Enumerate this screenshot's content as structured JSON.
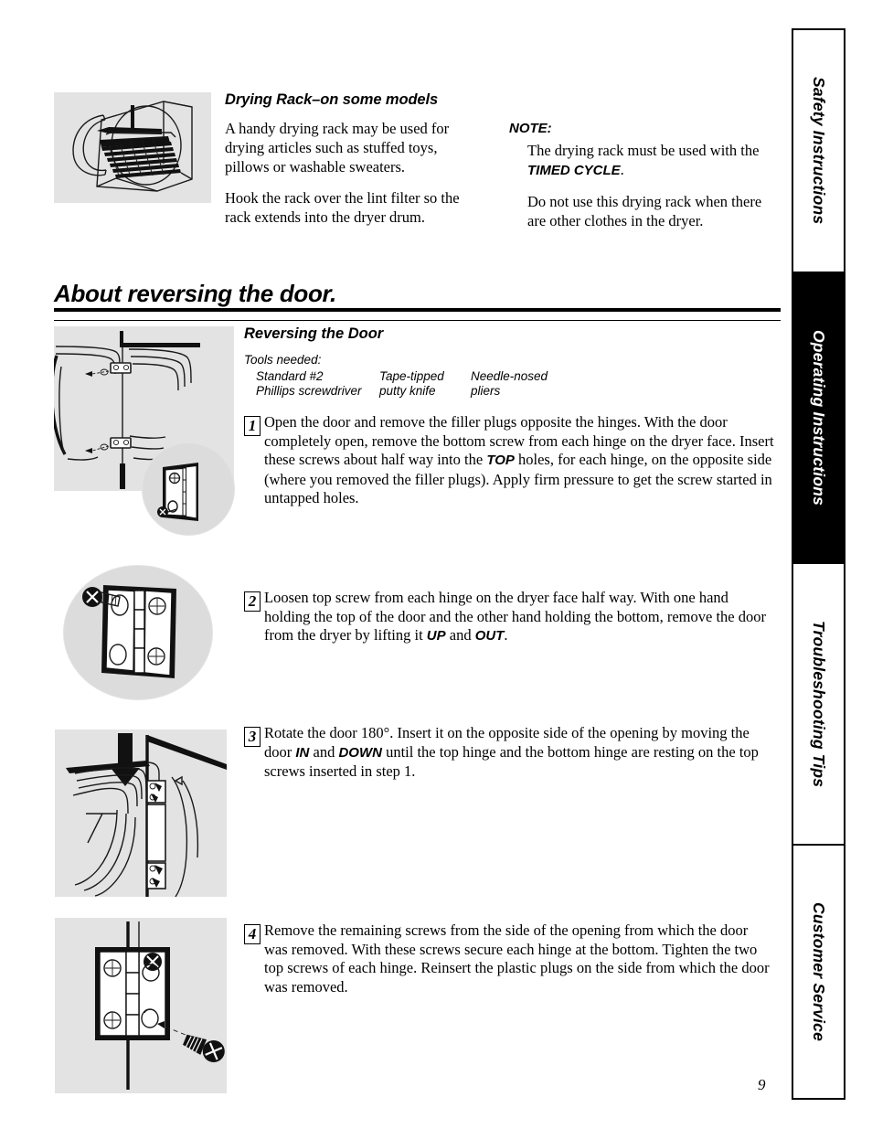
{
  "page_number": "9",
  "sidebar": {
    "tabs": [
      {
        "label": "Safety Instructions",
        "active": false
      },
      {
        "label": "Operating Instructions",
        "active": true
      },
      {
        "label": "Troubleshooting Tips",
        "active": false
      },
      {
        "label": "Customer Service",
        "active": false
      }
    ]
  },
  "drying_rack": {
    "heading": "Drying Rack–on some models",
    "paragraph_1": "A handy drying rack may be used for drying articles such as stuffed toys, pillows or washable sweaters.",
    "paragraph_2": "Hook the rack over the lint filter so the rack extends into the dryer drum.",
    "note_label": "NOTE:",
    "note_1_before": "The drying rack must be used with the ",
    "note_1_emphasis": "TIMED CYCLE",
    "note_1_after": ".",
    "note_2": "Do not use this drying rack when there are other clothes in the dryer."
  },
  "section": {
    "heading": "About reversing the door.",
    "subheading": "Reversing the Door",
    "tools_label": "Tools needed:",
    "tools": [
      "Standard #2\nPhillips screwdriver",
      "Tape-tipped\nputty knife",
      "Needle-nosed\npliers"
    ],
    "steps": [
      {
        "number": "1",
        "seg_1": "Open the door and remove the filler plugs opposite the hinges. With the door completely open, remove the bottom screw from each hinge on the dryer face. Insert these screws about half way into the ",
        "em_1": "TOP",
        "seg_2": " holes, for each hinge, on the opposite side (where you removed the filler plugs). Apply firm pressure to get the screw started in untapped holes.",
        "em_2": "",
        "seg_3": ""
      },
      {
        "number": "2",
        "seg_1": "Loosen top screw from each hinge on the dryer face half way. With one hand holding the top of the door and the other hand holding the bottom, remove the door from the dryer by lifting it ",
        "em_1": "UP",
        "seg_2": " and ",
        "em_2": "OUT",
        "seg_3": "."
      },
      {
        "number": "3",
        "seg_1": "Rotate the door 180°. Insert it on the opposite side of the opening by moving the door ",
        "em_1": "IN",
        "seg_2": " and ",
        "em_2": "DOWN",
        "seg_3": " until the top hinge and the bottom hinge are resting on the top screws inserted in step 1."
      },
      {
        "number": "4",
        "seg_1": "Remove the remaining screws from the side of the opening from which the door was removed. With these screws secure each hinge at the bottom. Tighten the two top screws of each hinge. Reinsert the plastic plugs on the side from which the door was removed.",
        "em_1": "",
        "seg_2": "",
        "em_2": "",
        "seg_3": ""
      }
    ]
  },
  "figures": {
    "drying_rack": "drying-rack-in-drum-illustration",
    "step_1": "dryer-front-hinge-screws-illustration",
    "step_1_detail": "hinge-closeup-circle-illustration",
    "step_2": "hinge-with-screw-circle-illustration",
    "step_3": "door-rotate-in-down-illustration",
    "step_4": "hinge-screw-insert-illustration"
  },
  "colors": {
    "figure_background": "#e3e3e3",
    "active_tab_background": "#000000",
    "active_tab_text": "#ffffff",
    "ink": "#000000"
  }
}
